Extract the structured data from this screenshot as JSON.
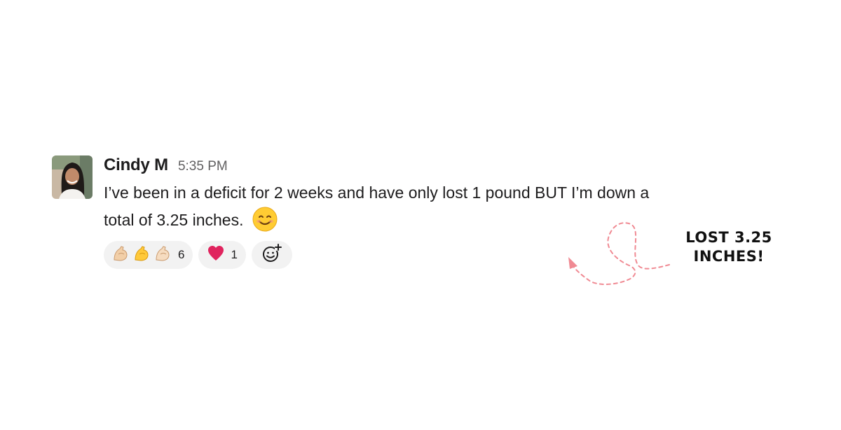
{
  "message": {
    "sender": "Cindy M",
    "timestamp": "5:35 PM",
    "text": "I’ve been in a deficit for 2 weeks and have only lost 1 pound BUT I’m down a total of 3.25 inches.",
    "inline_emoji": "smiling-face-icon"
  },
  "reactions": [
    {
      "icons": [
        "flexed-biceps-light-icon",
        "flexed-biceps-yellow-icon",
        "flexed-biceps-light-icon"
      ],
      "count": "6"
    },
    {
      "icons": [
        "red-heart-icon"
      ],
      "count": "1"
    },
    {
      "icons": [
        "add-reaction-icon"
      ]
    }
  ],
  "annotation": {
    "line1": "LOST 3.25",
    "line2": "INCHES!"
  },
  "colors": {
    "arrow": "#f08a93",
    "reaction_bg": "#f2f2f2",
    "heart": "#e0245e",
    "emoji_yellow": "#ffcc33"
  }
}
